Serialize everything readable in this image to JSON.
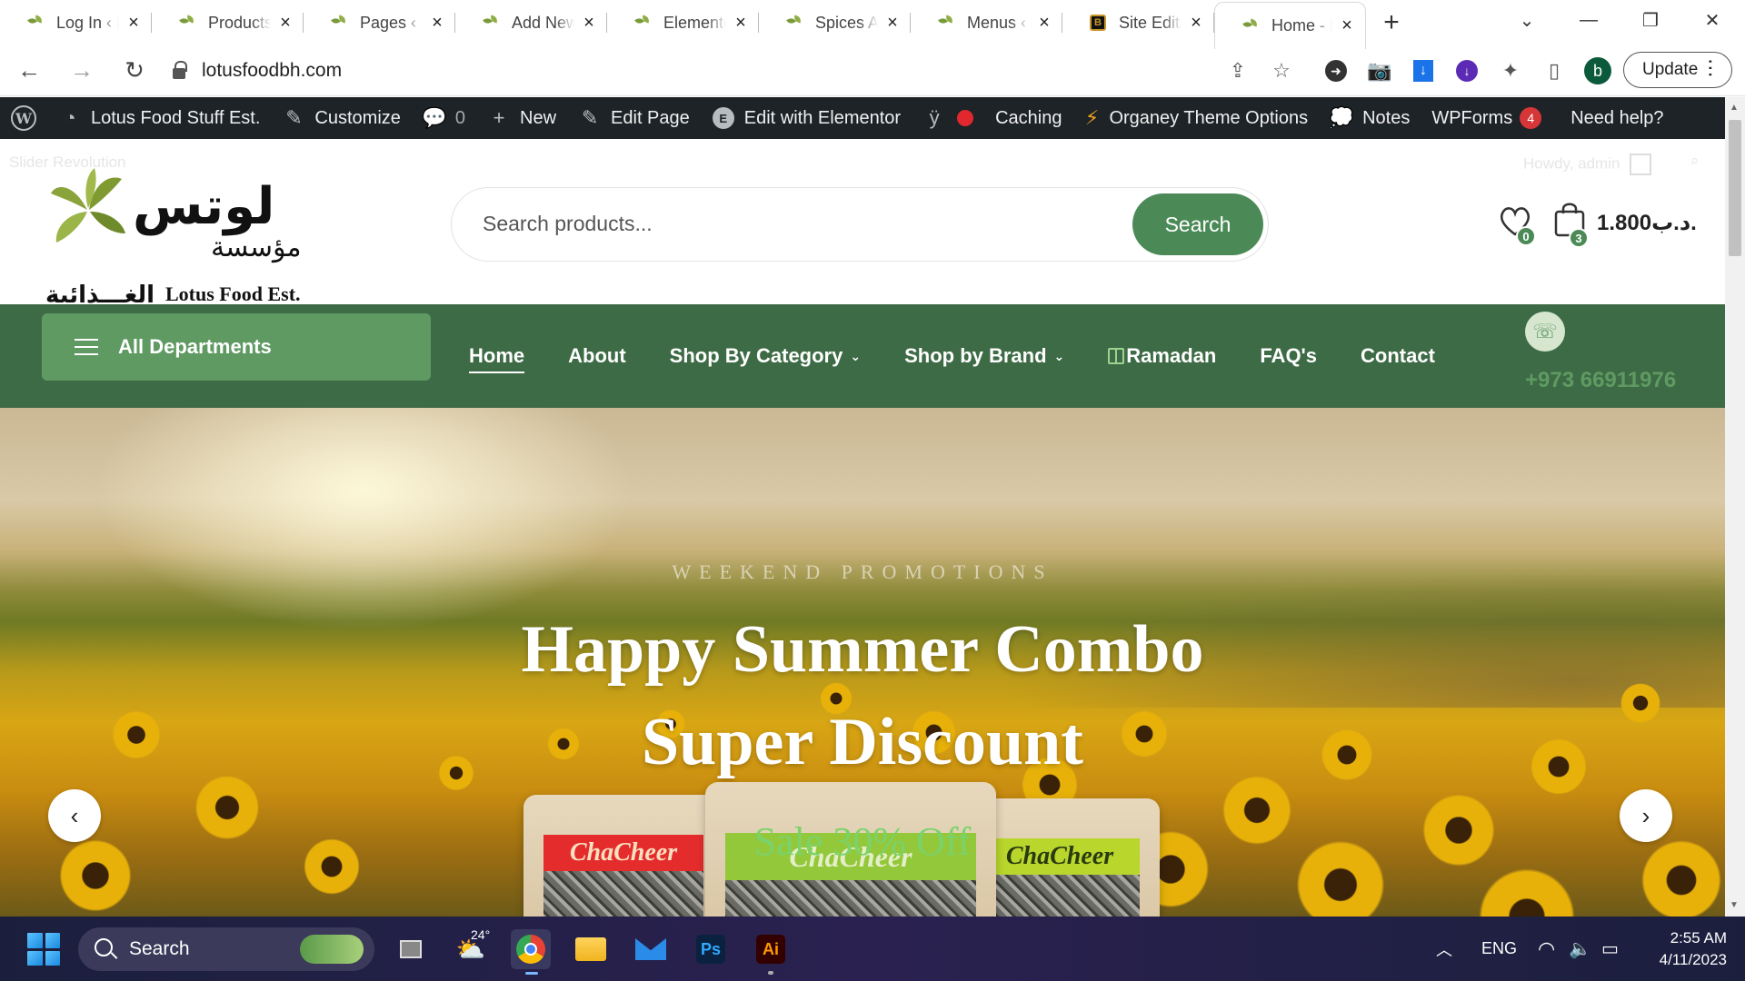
{
  "browser": {
    "tabs": [
      {
        "title": "Log In ‹ Lotus Food Stuff Est.",
        "favicon": "lotus-leaf-icon",
        "active": false
      },
      {
        "title": "Products ‹ Lotus",
        "favicon": "lotus-leaf-icon",
        "active": false
      },
      {
        "title": "Pages ‹ Lotus",
        "favicon": "lotus-leaf-icon",
        "active": false
      },
      {
        "title": "Add New Page",
        "favicon": "lotus-leaf-icon",
        "active": false
      },
      {
        "title": "Elementor",
        "favicon": "lotus-leaf-icon",
        "active": false
      },
      {
        "title": "Spices Archives",
        "favicon": "lotus-leaf-icon",
        "active": false
      },
      {
        "title": "Menus ‹ Lotus",
        "favicon": "lotus-leaf-icon",
        "active": false
      },
      {
        "title": "Site Edits",
        "favicon": "site-edits-icon",
        "active": false
      },
      {
        "title": "Home - Lotus",
        "favicon": "lotus-leaf-icon",
        "active": true
      }
    ],
    "url": "lotusfoodbh.com",
    "profile_initial": "b",
    "update_label": "Update"
  },
  "adminbar": {
    "site_name": "Lotus Food Stuff Est.",
    "customize": "Customize",
    "comments_count": "0",
    "new": "New",
    "edit_page": "Edit Page",
    "edit_elementor": "Edit with Elementor",
    "caching": "Caching",
    "theme_options": "Organey Theme Options",
    "notes": "Notes",
    "wpforms": "WPForms",
    "wpforms_count": "4",
    "help": "Need help?"
  },
  "site": {
    "ghost_slider": "Slider Revolution",
    "ghost_howdy": "Howdy, admin",
    "logo": {
      "ar_big": "لوتس",
      "ar_small": "مؤسسة",
      "ar_bottom": "الغـــذائية",
      "en": "Lotus Food Est."
    },
    "search": {
      "placeholder": "Search products...",
      "button": "Search"
    },
    "wishlist_count": "0",
    "cart_count": "3",
    "cart_total": "1.800د.ب.",
    "departments": "All Departments",
    "menu": [
      {
        "label": "Home",
        "active": true,
        "dropdown": false
      },
      {
        "label": "About",
        "active": false,
        "dropdown": false
      },
      {
        "label": "Shop By Category",
        "active": false,
        "dropdown": true
      },
      {
        "label": "Shop by Brand",
        "active": false,
        "dropdown": true
      },
      {
        "label": "Ramadan",
        "active": false,
        "dropdown": false
      },
      {
        "label": "FAQ's",
        "active": false,
        "dropdown": false
      },
      {
        "label": "Contact",
        "active": false,
        "dropdown": false
      }
    ],
    "phone": "+973 66911976",
    "hero": {
      "subtitle": "WEEKEND PROMOTIONS",
      "title_line1": "Happy Summer Combo",
      "title_line2": "Super Discount",
      "sale": "Sale 30% Off",
      "bag_labels": [
        "ChaCheer",
        "ChaCheer",
        "ChaCheer"
      ]
    }
  },
  "taskbar": {
    "search": "Search",
    "weather": "24°",
    "lang": "ENG",
    "time": "2:55 AM",
    "date": "4/11/2023"
  },
  "colors": {
    "brand_green": "#3d6b45",
    "button_green": "#4b8a57",
    "admin_bar": "#1d2327",
    "badge_red": "#d63638"
  }
}
